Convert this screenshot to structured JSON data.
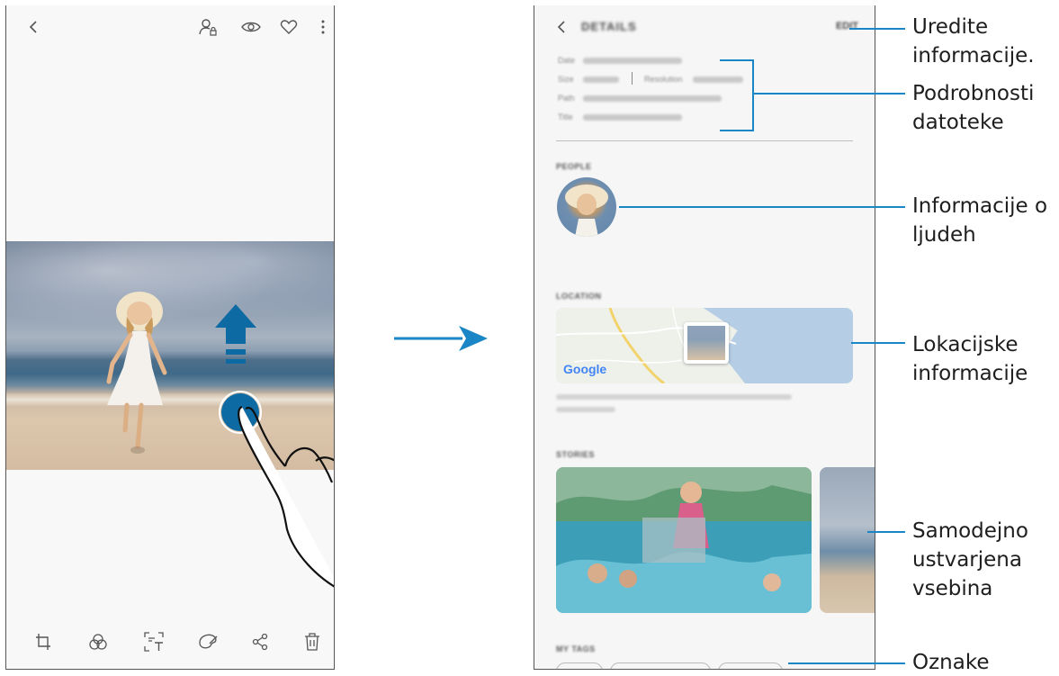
{
  "left_screen": {
    "top_icons": [
      "back-icon",
      "tag-person-icon",
      "bixby-vision-icon",
      "favorite-icon",
      "more-options-icon"
    ],
    "bottom_icons": [
      "crop-icon",
      "filter-icon",
      "text-extract-icon",
      "decorate-icon",
      "share-icon",
      "delete-icon"
    ]
  },
  "right_screen": {
    "header": {
      "title": "DETAILS",
      "edit_label": "EDIT"
    },
    "file_info": {
      "date_label": "Date",
      "size_label": "Size",
      "resolution_label": "Resolution",
      "path_label": "Path",
      "title_label": "Title"
    },
    "sections": {
      "people": "PEOPLE",
      "location": "LOCATION",
      "stories": "STORIES",
      "tags": "MY TAGS"
    },
    "map": {
      "provider_logo": "Google"
    }
  },
  "callouts": [
    {
      "text": "Uredite\ninformacije."
    },
    {
      "text": "Podrobnosti\ndatoteke"
    },
    {
      "text": "Informacije o\nljudeh"
    },
    {
      "text": "Lokacijske\ninformacije"
    },
    {
      "text": "Samodejno\nustvarjena\nvsebina"
    },
    {
      "text": "Oznake"
    }
  ],
  "colors": {
    "accent_blue": "#1b86c5",
    "gesture_blue": "#0d6aa3"
  }
}
